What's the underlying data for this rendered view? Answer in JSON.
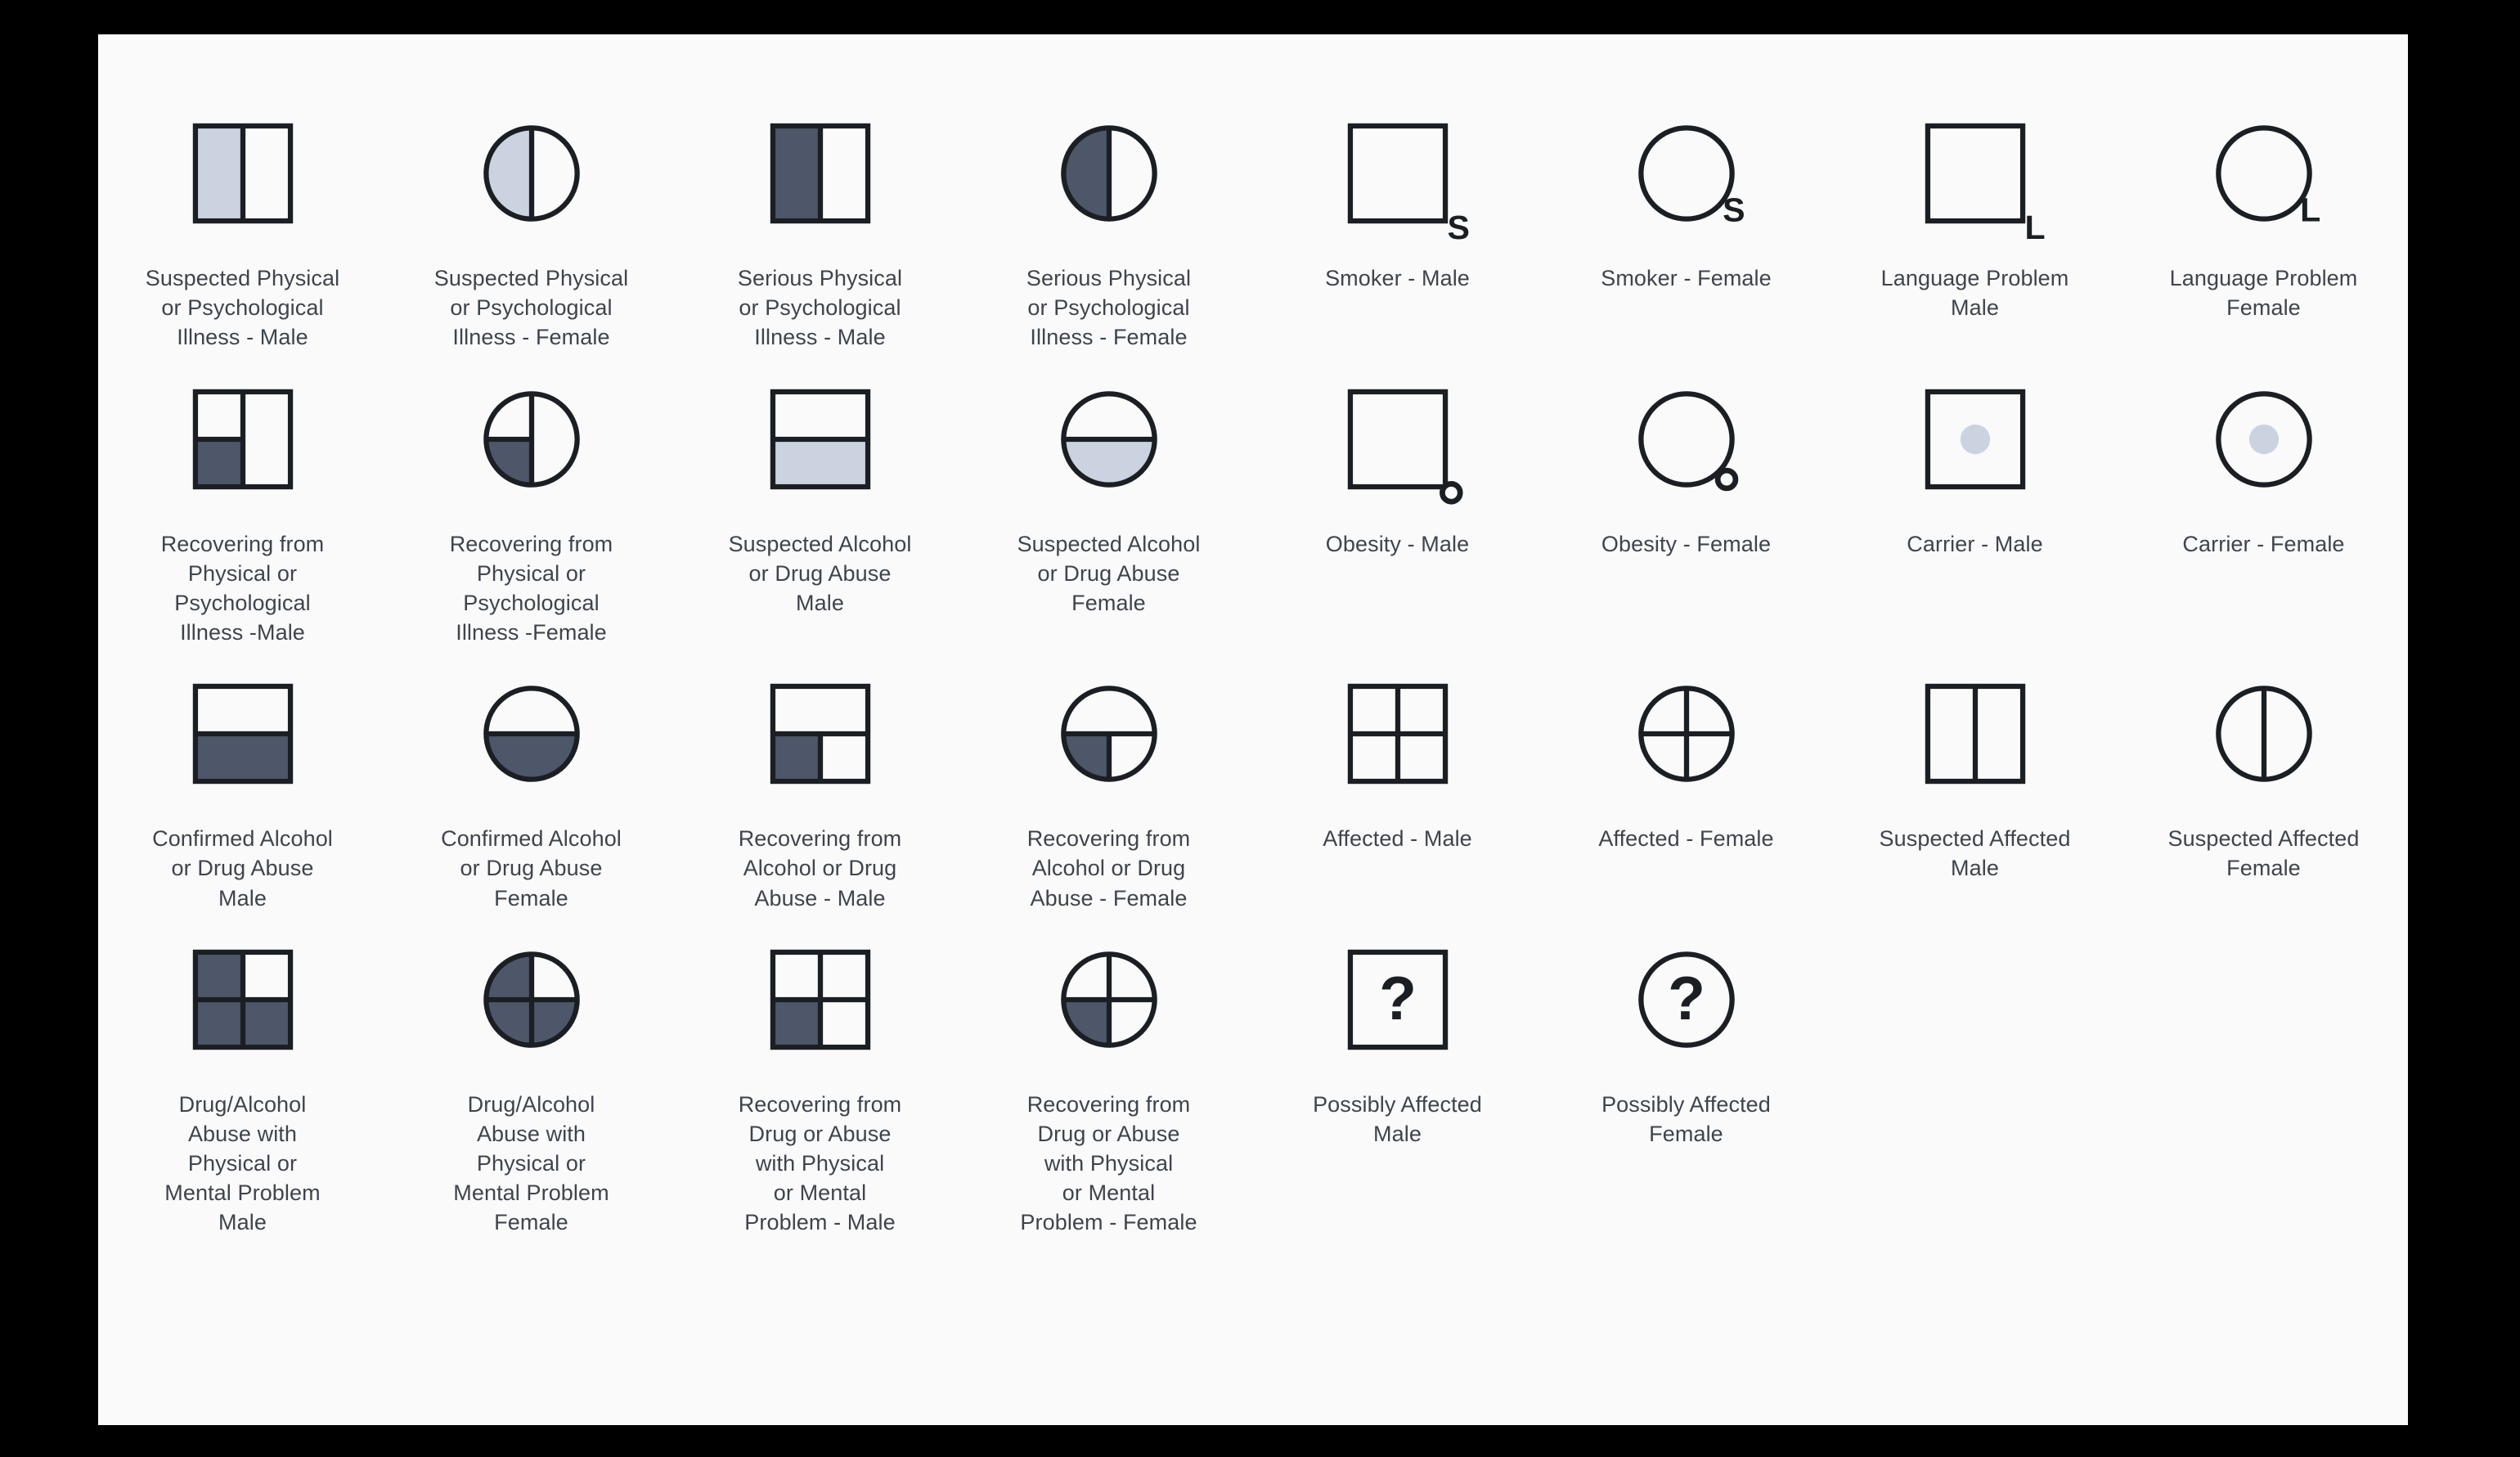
{
  "colors": {
    "page_background": "#000000",
    "panel_background": "#fafafa",
    "stroke": "#1b1f24",
    "fill_dark": "#4e5769",
    "fill_light": "#ccd3e0",
    "label_text": "#3f444c"
  },
  "legend": {
    "title": "",
    "columns": 8,
    "items": [
      {
        "id": "suspected-physical-psych-illness-male",
        "label": "Suspected Physical\nor Psychological\nIllness - Male",
        "shape": "square",
        "fill_pattern": "left-half",
        "fill_color": "light",
        "marker": "",
        "dividers": "vertical-full"
      },
      {
        "id": "suspected-physical-psych-illness-female",
        "label": "Suspected Physical\nor Psychological\nIllness - Female",
        "shape": "circle",
        "fill_pattern": "left-half",
        "fill_color": "light",
        "marker": "",
        "dividers": "vertical-full"
      },
      {
        "id": "serious-physical-psych-illness-male",
        "label": "Serious Physical\nor Psychological\nIllness - Male",
        "shape": "square",
        "fill_pattern": "left-half",
        "fill_color": "dark",
        "marker": "",
        "dividers": "vertical-full"
      },
      {
        "id": "serious-physical-psych-illness-female",
        "label": "Serious Physical\nor Psychological\nIllness - Female",
        "shape": "circle",
        "fill_pattern": "left-half",
        "fill_color": "dark",
        "marker": "",
        "dividers": "vertical-full"
      },
      {
        "id": "smoker-male",
        "label": "Smoker - Male",
        "shape": "square",
        "fill_pattern": "none",
        "fill_color": "none",
        "marker": "S",
        "dividers": "none"
      },
      {
        "id": "smoker-female",
        "label": "Smoker - Female",
        "shape": "circle",
        "fill_pattern": "none",
        "fill_color": "none",
        "marker": "S",
        "dividers": "none"
      },
      {
        "id": "language-problem-male",
        "label": "Language Problem\nMale",
        "shape": "square",
        "fill_pattern": "none",
        "fill_color": "none",
        "marker": "L",
        "dividers": "none"
      },
      {
        "id": "language-problem-female",
        "label": "Language Problem\nFemale",
        "shape": "circle",
        "fill_pattern": "none",
        "fill_color": "none",
        "marker": "L",
        "dividers": "none"
      },
      {
        "id": "recovering-physical-psych-illness-male",
        "label": "Recovering from\nPhysical or\nPsychological\nIllness -Male",
        "shape": "square",
        "fill_pattern": "bottom-left-quadrant",
        "fill_color": "dark",
        "marker": "",
        "dividers": "vertical-full-horizontal-left"
      },
      {
        "id": "recovering-physical-psych-illness-female",
        "label": "Recovering from\nPhysical or\nPsychological\nIllness -Female",
        "shape": "circle",
        "fill_pattern": "bottom-left-quadrant",
        "fill_color": "dark",
        "marker": "",
        "dividers": "vertical-full-horizontal-left"
      },
      {
        "id": "suspected-alcohol-drug-abuse-male",
        "label": "Suspected Alcohol\nor Drug Abuse\nMale",
        "shape": "square",
        "fill_pattern": "bottom-half",
        "fill_color": "light",
        "marker": "",
        "dividers": "horizontal-full"
      },
      {
        "id": "suspected-alcohol-drug-abuse-female",
        "label": "Suspected Alcohol\nor Drug Abuse\nFemale",
        "shape": "circle",
        "fill_pattern": "bottom-half",
        "fill_color": "light",
        "marker": "",
        "dividers": "horizontal-full"
      },
      {
        "id": "obesity-male",
        "label": "Obesity - Male",
        "shape": "square",
        "fill_pattern": "none",
        "fill_color": "none",
        "marker": "o",
        "dividers": "none"
      },
      {
        "id": "obesity-female",
        "label": "Obesity - Female",
        "shape": "circle",
        "fill_pattern": "none",
        "fill_color": "none",
        "marker": "o",
        "dividers": "none"
      },
      {
        "id": "carrier-male",
        "label": "Carrier - Male",
        "shape": "square",
        "fill_pattern": "center-dot",
        "fill_color": "light",
        "marker": "",
        "dividers": "none"
      },
      {
        "id": "carrier-female",
        "label": "Carrier - Female",
        "shape": "circle",
        "fill_pattern": "center-dot",
        "fill_color": "light",
        "marker": "",
        "dividers": "none"
      },
      {
        "id": "confirmed-alcohol-drug-abuse-male",
        "label": "Confirmed Alcohol\nor Drug Abuse\nMale",
        "shape": "square",
        "fill_pattern": "bottom-half",
        "fill_color": "dark",
        "marker": "",
        "dividers": "horizontal-full"
      },
      {
        "id": "confirmed-alcohol-drug-abuse-female",
        "label": "Confirmed Alcohol\nor Drug Abuse\nFemale",
        "shape": "circle",
        "fill_pattern": "bottom-half",
        "fill_color": "dark",
        "marker": "",
        "dividers": "horizontal-full"
      },
      {
        "id": "recovering-alcohol-drug-abuse-male",
        "label": "Recovering from\nAlcohol or Drug\nAbuse - Male",
        "shape": "square",
        "fill_pattern": "bottom-left-quadrant",
        "fill_color": "dark",
        "marker": "",
        "dividers": "horizontal-full-vertical-bottom"
      },
      {
        "id": "recovering-alcohol-drug-abuse-female",
        "label": "Recovering from\nAlcohol or Drug\nAbuse - Female",
        "shape": "circle",
        "fill_pattern": "bottom-left-quadrant",
        "fill_color": "dark",
        "marker": "",
        "dividers": "horizontal-full-vertical-bottom"
      },
      {
        "id": "affected-male",
        "label": "Affected - Male",
        "shape": "square",
        "fill_pattern": "none",
        "fill_color": "none",
        "marker": "",
        "dividers": "cross"
      },
      {
        "id": "affected-female",
        "label": "Affected - Female",
        "shape": "circle",
        "fill_pattern": "none",
        "fill_color": "none",
        "marker": "",
        "dividers": "cross"
      },
      {
        "id": "suspected-affected-male",
        "label": "Suspected Affected\nMale",
        "shape": "square",
        "fill_pattern": "none",
        "fill_color": "none",
        "marker": "",
        "dividers": "vertical-full"
      },
      {
        "id": "suspected-affected-female",
        "label": "Suspected Affected\nFemale",
        "shape": "circle",
        "fill_pattern": "none",
        "fill_color": "none",
        "marker": "",
        "dividers": "vertical-full"
      },
      {
        "id": "drug-alcohol-abuse-physical-mental-male",
        "label": "Drug/Alcohol\nAbuse with\nPhysical or\nMental Problem\nMale",
        "shape": "square",
        "fill_pattern": "three-quadrants",
        "fill_color": "dark",
        "marker": "",
        "dividers": "cross"
      },
      {
        "id": "drug-alcohol-abuse-physical-mental-female",
        "label": "Drug/Alcohol\nAbuse with\nPhysical or\nMental Problem\nFemale",
        "shape": "circle",
        "fill_pattern": "three-quadrants",
        "fill_color": "dark",
        "marker": "",
        "dividers": "cross"
      },
      {
        "id": "recovering-drug-abuse-physical-mental-male",
        "label": "Recovering from\nDrug or Abuse\nwith Physical\nor Mental\nProblem - Male",
        "shape": "square",
        "fill_pattern": "bottom-left-quadrant",
        "fill_color": "dark",
        "marker": "",
        "dividers": "cross"
      },
      {
        "id": "recovering-drug-abuse-physical-mental-female",
        "label": "Recovering from\nDrug or Abuse\nwith Physical\nor Mental\nProblem - Female",
        "shape": "circle",
        "fill_pattern": "bottom-left-quadrant",
        "fill_color": "dark",
        "marker": "",
        "dividers": "cross"
      },
      {
        "id": "possibly-affected-male",
        "label": "Possibly Affected\nMale",
        "shape": "square",
        "fill_pattern": "none",
        "fill_color": "none",
        "marker": "?",
        "dividers": "none"
      },
      {
        "id": "possibly-affected-female",
        "label": "Possibly Affected\nFemale",
        "shape": "circle",
        "fill_pattern": "none",
        "fill_color": "none",
        "marker": "?",
        "dividers": "none"
      }
    ]
  }
}
